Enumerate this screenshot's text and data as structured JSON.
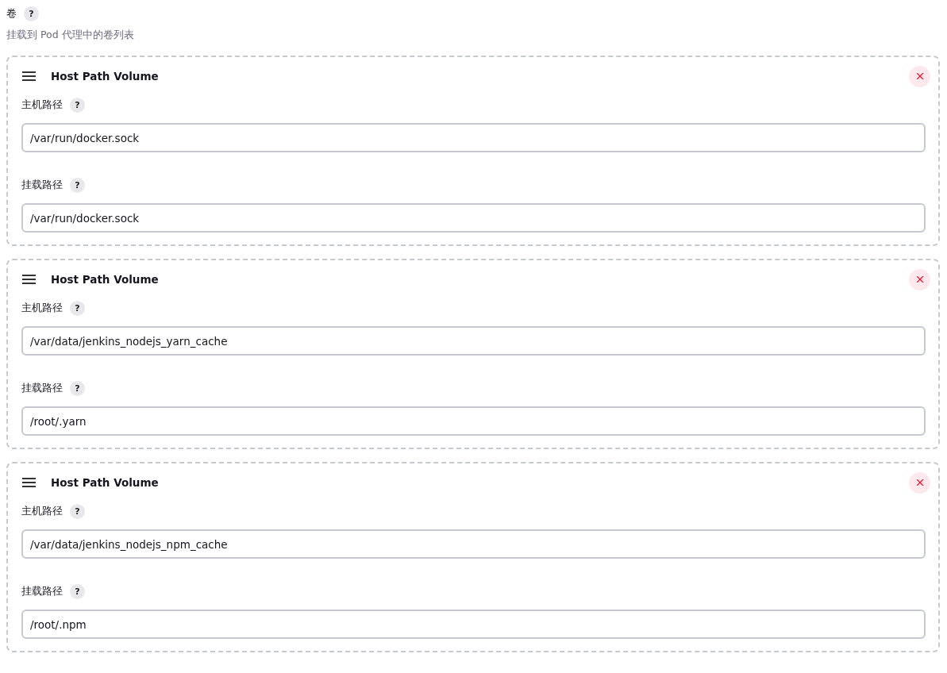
{
  "section": {
    "title": "卷",
    "help": "?",
    "description": "挂载到 Pod 代理中的卷列表"
  },
  "volumes": [
    {
      "title": "Host Path Volume",
      "fields": [
        {
          "label": "主机路径",
          "help": "?",
          "value": "/var/run/docker.sock"
        },
        {
          "label": "挂载路径",
          "help": "?",
          "value": "/var/run/docker.sock"
        }
      ]
    },
    {
      "title": "Host Path Volume",
      "fields": [
        {
          "label": "主机路径",
          "help": "?",
          "value": "/var/data/jenkins_nodejs_yarn_cache"
        },
        {
          "label": "挂载路径",
          "help": "?",
          "value": "/root/.yarn"
        }
      ]
    },
    {
      "title": "Host Path Volume",
      "fields": [
        {
          "label": "主机路径",
          "help": "?",
          "value": "/var/data/jenkins_nodejs_npm_cache"
        },
        {
          "label": "挂载路径",
          "help": "?",
          "value": "/root/.npm"
        }
      ]
    }
  ]
}
